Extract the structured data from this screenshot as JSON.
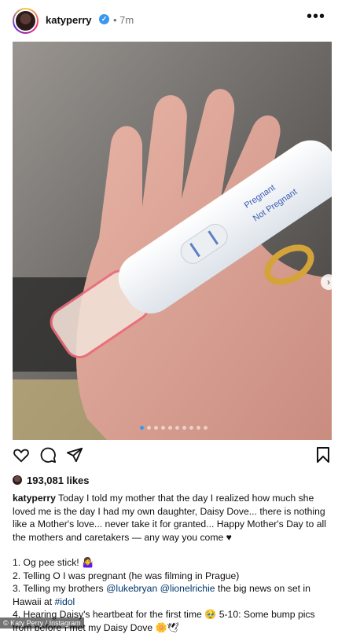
{
  "header": {
    "username": "katyperry",
    "time": "7m"
  },
  "post_image": {
    "test_labels": {
      "positive": "Pregnant",
      "negative": "Not Pregnant"
    },
    "carousel": {
      "count": 10,
      "active_index": 0
    }
  },
  "likes": "193,081 likes",
  "caption": {
    "username": "katyperry",
    "intro": "Today I told my mother that the day I realized how much she loved me is the day I had my own daughter, Daisy Dove... there is nothing like a Mother's love... never take it for granted... Happy Mother's Day to all the mothers and caretakers — any way you come ♥",
    "line1": "1. Og pee stick! 🤷‍♀️",
    "line2": "2. Telling O I was pregnant (he was filming in Prague)",
    "line3_pre": "3. Telling my brothers ",
    "line3_m1": "@lukebryan",
    "line3_m2": "@lionelrichie",
    "line3_post": " the big news on set in Hawaii at ",
    "line3_tag": "#idol",
    "line4": "4. Hearing Daisy's heartbeat for the first time 🥹 5-10: Some bump pics from before I met my Daisy Dove 🌼🕊"
  },
  "footer": "© Katy Perry / Instagram",
  "colors": {
    "link": "#00376b",
    "verified": "#3897f0",
    "test_ink": "#3b5bb5"
  }
}
